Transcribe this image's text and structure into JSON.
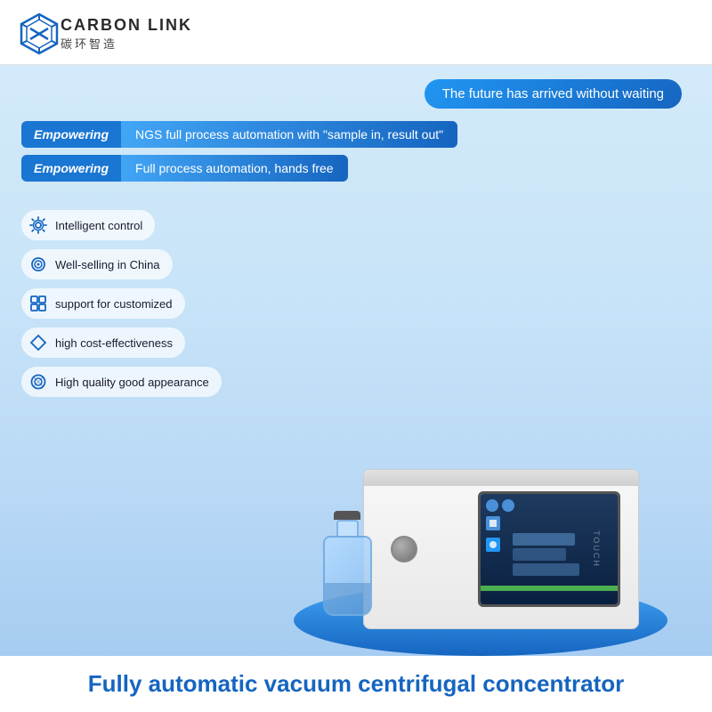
{
  "header": {
    "logo_en": "CARBON LINK",
    "logo_cn": "碳环智造"
  },
  "banner": {
    "future_text": "The future has arrived without waiting"
  },
  "empowering": [
    {
      "label": "Empowering",
      "text": "NGS full process automation with \"sample in, result out\""
    },
    {
      "label": "Empowering",
      "text": "Full process automation, hands free"
    }
  ],
  "features": [
    {
      "icon": "⚙",
      "text": "Intelligent control",
      "icon_name": "gear-icon"
    },
    {
      "icon": "◎",
      "text": "Well-selling in China",
      "icon_name": "award-icon"
    },
    {
      "icon": "▦",
      "text": "support for customized",
      "icon_name": "grid-icon"
    },
    {
      "icon": "◇",
      "text": "high cost-effectiveness",
      "icon_name": "diamond-icon"
    },
    {
      "icon": "✿",
      "text": "High quality good appearance",
      "icon_name": "quality-icon"
    }
  ],
  "bottom_title": "Fully automatic vacuum centrifugal concentrator"
}
